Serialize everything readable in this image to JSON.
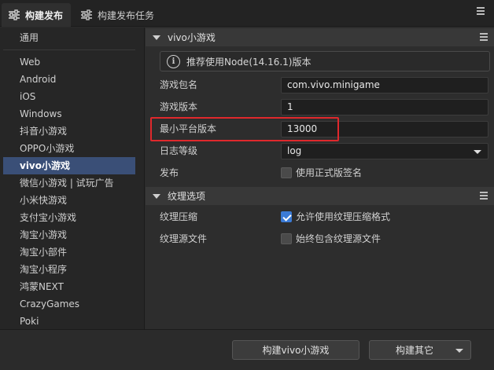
{
  "tabs": [
    {
      "label": "构建发布",
      "icon": "sliders-icon",
      "active": true
    },
    {
      "label": "构建发布任务",
      "icon": "sliders-icon",
      "active": false
    }
  ],
  "nav": {
    "general": "通用",
    "items": [
      "Web",
      "Android",
      "iOS",
      "Windows",
      "抖音小游戏",
      "OPPO小游戏",
      "vivo小游戏",
      "微信小游戏 | 试玩广告",
      "小米快游戏",
      "支付宝小游戏",
      "淘宝小游戏",
      "淘宝小部件",
      "淘宝小程序",
      "鸿蒙NEXT",
      "CrazyGames",
      "Poki"
    ],
    "selected": "vivo小游戏"
  },
  "section_vivo": {
    "title": "vivo小游戏",
    "info": "推荐使用Node(14.16.1)版本",
    "package_label": "游戏包名",
    "package_value": "com.vivo.minigame",
    "version_label": "游戏版本",
    "version_value": "1",
    "min_platform_label": "最小平台版本",
    "min_platform_value": "13000",
    "log_label": "日志等级",
    "log_value": "log",
    "publish_label": "发布",
    "publish_checkbox_label": "使用正式版签名"
  },
  "section_texture": {
    "title": "纹理选项",
    "compress_label": "纹理压缩",
    "compress_checkbox_label": "允许使用纹理压缩格式",
    "source_label": "纹理源文件",
    "source_checkbox_label": "始终包含纹理源文件"
  },
  "footer": {
    "build_button": "构建vivo小游戏",
    "build_other_button": "构建其它"
  },
  "colors": {
    "accent": "#3b7bd6",
    "selected_nav": "#3a4f77",
    "highlight": "#e0282c"
  }
}
